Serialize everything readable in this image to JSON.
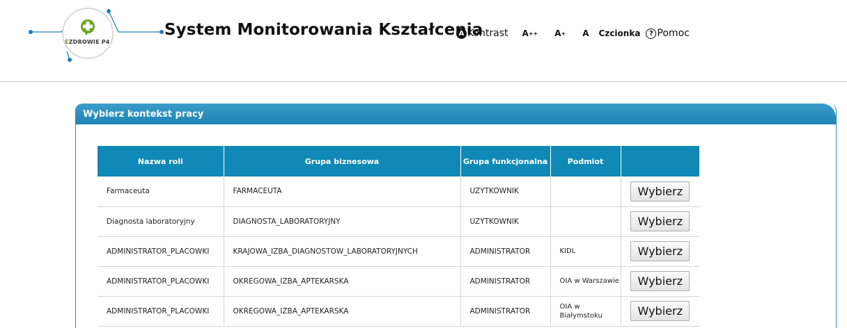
{
  "header": {
    "logo_text_e": "E",
    "logo_text_rest": "ZDROWIE P4",
    "title": "System Monitorowania Kształcenia",
    "toolbar": {
      "contrast_icon": "A",
      "contrast_label": "Kontrast",
      "font_large": "A",
      "font_large_sup": "++",
      "font_medium": "A",
      "font_medium_sup": "+",
      "font_normal": "A",
      "font_label": "Czcionka",
      "help_icon": "?",
      "help_label": "Pomoc"
    }
  },
  "panel": {
    "title": "Wybierz kontekst pracy"
  },
  "table": {
    "headers": [
      "Nazwa roli",
      "Grupa biznesowa",
      "Grupa funkcjonalna",
      "Podmiot",
      ""
    ],
    "rows": [
      {
        "rola": "Farmaceuta",
        "grupa_biznesowa": "FARMACEUTA",
        "grupa_funkcjonalna": "UZYTKOWNIK",
        "podmiot": "",
        "action": "Wybierz"
      },
      {
        "rola": "Diagnosta laboratoryjny",
        "grupa_biznesowa": "DIAGNOSTA_LABORATORYJNY",
        "grupa_funkcjonalna": "UZYTKOWNIK",
        "podmiot": "",
        "action": "Wybierz"
      },
      {
        "rola": "ADMINISTRATOR_PLACOWKI",
        "grupa_biznesowa": "KRAJOWA_IZBA_DIAGNOSTOW_LABORATORYJNYCH",
        "grupa_funkcjonalna": "ADMINISTRATOR",
        "podmiot": "KIDL",
        "action": "Wybierz"
      },
      {
        "rola": "ADMINISTRATOR_PLACOWKI",
        "grupa_biznesowa": "OKREGOWA_IZBA_APTEKARSKA",
        "grupa_funkcjonalna": "ADMINISTRATOR",
        "podmiot": "OIA w Warszawie",
        "action": "Wybierz"
      },
      {
        "rola": "ADMINISTRATOR_PLACOWKI",
        "grupa_biznesowa": "OKREGOWA_IZBA_APTEKARSKA",
        "grupa_funkcjonalna": "ADMINISTRATOR",
        "podmiot": "OIA w Białymstoku",
        "action": "Wybierz"
      }
    ]
  },
  "colors": {
    "accent": "#1089b6",
    "logo_green": "#6aa31c",
    "logo_blue": "#1e7fb0"
  }
}
